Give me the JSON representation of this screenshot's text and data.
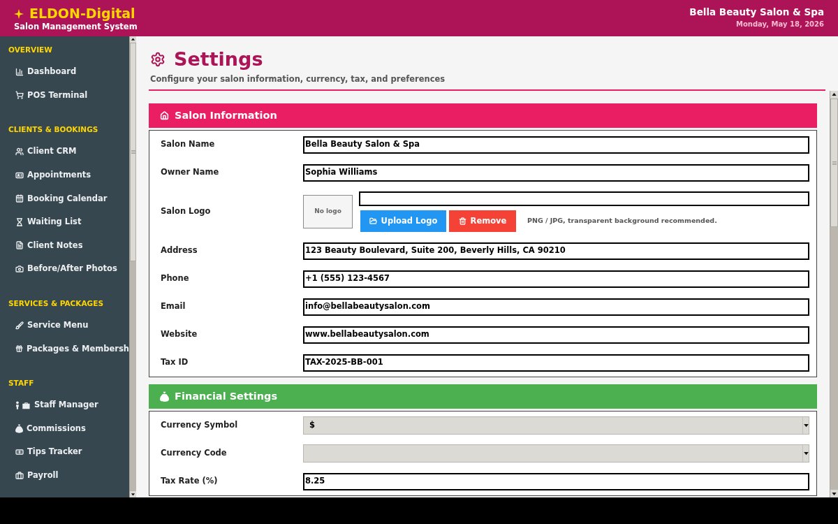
{
  "header": {
    "brand": "ELDON-Digital",
    "tagline": "Salon Management System",
    "business_name": "Bella Beauty Salon & Spa",
    "date": "Monday, May 18, 2026"
  },
  "sidebar": {
    "groups": [
      {
        "title": "OVERVIEW",
        "items": [
          {
            "label": "Dashboard",
            "selected": false
          },
          {
            "label": "POS Terminal",
            "selected": false
          }
        ]
      },
      {
        "title": "CLIENTS & BOOKINGS",
        "items": [
          {
            "label": "Client CRM",
            "selected": false
          },
          {
            "label": "Appointments",
            "selected": false
          },
          {
            "label": "Booking Calendar",
            "selected": false
          },
          {
            "label": "Waiting List",
            "selected": false
          },
          {
            "label": "Client Notes",
            "selected": false
          },
          {
            "label": "Before/After Photos",
            "selected": false
          }
        ]
      },
      {
        "title": "SERVICES & PACKAGES",
        "items": [
          {
            "label": "Service Menu",
            "selected": false
          },
          {
            "label": "Packages & Membersh",
            "selected": false
          }
        ]
      },
      {
        "title": "STAFF",
        "items": [
          {
            "label": "Staff Manager",
            "selected": false
          },
          {
            "label": "Commissions",
            "selected": false
          },
          {
            "label": "Tips Tracker",
            "selected": false
          },
          {
            "label": "Payroll",
            "selected": false
          }
        ]
      }
    ]
  },
  "page": {
    "title": "Settings",
    "subtitle": "Configure your salon information, currency, tax, and preferences"
  },
  "sections": [
    {
      "title": "Salon Information",
      "color": "#e91e63",
      "fields": [
        {
          "kind": "text",
          "label": "Salon Name",
          "value": "Bella Beauty Salon & Spa"
        },
        {
          "kind": "text",
          "label": "Owner Name",
          "value": "Sophia Williams"
        },
        {
          "kind": "logo",
          "label": "Salon Logo",
          "preview": "No logo",
          "buttons": [
            {
              "kind": "upload",
              "label": "Upload Logo"
            },
            {
              "kind": "remove",
              "label": "Remove"
            }
          ],
          "hint": "PNG / JPG, transparent background recommended."
        },
        {
          "kind": "text",
          "label": "Address",
          "value": "123 Beauty Boulevard, Suite 200, Beverly Hills, CA 90210"
        },
        {
          "kind": "text",
          "label": "Phone",
          "value": "+1 (555) 123-4567"
        },
        {
          "kind": "text",
          "label": "Email",
          "value": "info@bellabeautysalon.com"
        },
        {
          "kind": "text",
          "label": "Website",
          "value": "www.bellabeautysalon.com"
        },
        {
          "kind": "text",
          "label": "Tax ID",
          "value": "TAX-2025-BB-001"
        }
      ]
    },
    {
      "title": "Financial Settings",
      "color": "#4caf50",
      "fields": [
        {
          "kind": "select",
          "label": "Currency Symbol",
          "value": "$"
        },
        {
          "kind": "select",
          "label": "Currency Code"
        },
        {
          "kind": "text",
          "label": "Tax Rate (%)",
          "value": "8.25"
        }
      ]
    }
  ]
}
